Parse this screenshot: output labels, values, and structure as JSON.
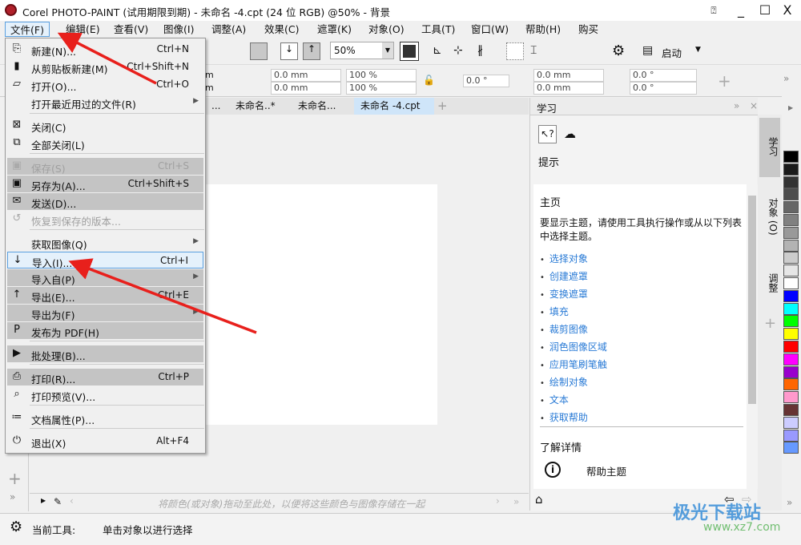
{
  "window": {
    "title": "Corel PHOTO-PAINT (试用期限到期) - 未命名 -4.cpt (24 位 RGB) @50% - 背景",
    "min": "_",
    "max": "☐",
    "close": "X"
  },
  "menubar": [
    "文件(F)",
    "编辑(E)",
    "查看(V)",
    "图像(I)",
    "调整(A)",
    "效果(C)",
    "遮罩(K)",
    "对象(O)",
    "工具(T)",
    "窗口(W)",
    "帮助(H)",
    "购买"
  ],
  "toolbar": {
    "zoom": "50%",
    "launch": "启动"
  },
  "propbar": {
    "fields": [
      "0.0 mm",
      "0.0 mm",
      "100 %",
      "100 %",
      "0.0 °",
      "0.0 mm",
      "0.0 mm",
      "0.0 °",
      "0.0 °"
    ],
    "w_prefix": "m"
  },
  "tabs": [
    "...",
    "未命名..*",
    "未命名...",
    "未命名 -4.cpt"
  ],
  "file_menu": [
    {
      "label": "新建(N)...",
      "shortcut": "Ctrl+N",
      "icon": "new-document-icon"
    },
    {
      "label": "从剪贴板新建(M)",
      "shortcut": "Ctrl+Shift+N",
      "icon": "clipboard-icon"
    },
    {
      "label": "打开(O)...",
      "shortcut": "Ctrl+O",
      "icon": "folder-icon"
    },
    {
      "label": "打开最近用过的文件(R)",
      "submenu": true
    },
    {
      "label": "关闭(C)",
      "icon": "close-document-icon"
    },
    {
      "label": "全部关闭(L)",
      "icon": "close-all-icon"
    },
    {
      "label": "保存(S)",
      "shortcut": "Ctrl+S",
      "disabled": true,
      "icon": "save-icon"
    },
    {
      "label": "另存为(A)...",
      "shortcut": "Ctrl+Shift+S",
      "icon": "save-as-icon"
    },
    {
      "label": "发送(D)...",
      "icon": "send-icon"
    },
    {
      "label": "恢复到保存的版本...",
      "disabled": true,
      "icon": "revert-icon"
    },
    {
      "label": "获取图像(Q)",
      "submenu": true
    },
    {
      "label": "导入(I)...",
      "shortcut": "Ctrl+I",
      "highlighted": true,
      "icon": "import-icon"
    },
    {
      "label": "导入自(P)",
      "submenu": true
    },
    {
      "label": "导出(E)...",
      "shortcut": "Ctrl+E",
      "icon": "export-icon"
    },
    {
      "label": "导出为(F)",
      "submenu": true
    },
    {
      "label": "发布为 PDF(H)",
      "icon": "pdf-icon"
    },
    {
      "label": "批处理(B)...",
      "icon": "batch-icon"
    },
    {
      "label": "打印(R)...",
      "shortcut": "Ctrl+P",
      "icon": "print-icon"
    },
    {
      "label": "打印预览(V)...",
      "icon": "print-preview-icon"
    },
    {
      "label": "文档属性(P)...",
      "icon": "document-properties-icon"
    },
    {
      "label": "退出(X)",
      "shortcut": "Alt+F4",
      "icon": "power-icon"
    }
  ],
  "panel": {
    "title": "学习",
    "hints": "提示",
    "home": "主页",
    "description": "要显示主题，请使用工具执行操作或从以下列表中选择主题。",
    "topics": [
      "选择对象",
      "创建遮罩",
      "变换遮罩",
      "填充",
      "裁剪图像",
      "润色图像区域",
      "应用笔刷笔触",
      "绘制对象",
      "文本",
      "获取帮助"
    ],
    "learn_more": "了解详情",
    "help_topics": "帮助主题"
  },
  "vtabs": [
    "学习",
    "对象 (O)",
    "调整"
  ],
  "palette": [
    "#000000",
    "#1a1a1a",
    "#333333",
    "#4d4d4d",
    "#666666",
    "#808080",
    "#999999",
    "#b3b3b3",
    "#cccccc",
    "#e6e6e6",
    "#ffffff",
    "#0000ff",
    "#00ffff",
    "#00ff00",
    "#ffff00",
    "#ff0000",
    "#ff00ff",
    "#9900cc",
    "#ff6600",
    "#ff99cc",
    "#663333",
    "#ccccff",
    "#9999ff",
    "#6699ff"
  ],
  "colorbar": {
    "hint": "将颜色(或对象)拖动至此处，以便将这些颜色与图像存储在一起"
  },
  "status": {
    "label": "当前工具:",
    "text": "单击对象以进行选择"
  },
  "watermark": {
    "name": "极光下载站",
    "url": "www.xz7.com"
  },
  "colors": {
    "arrow": "#e8201c",
    "highlight": "#e5f1fb",
    "link": "#2a7bd6"
  }
}
